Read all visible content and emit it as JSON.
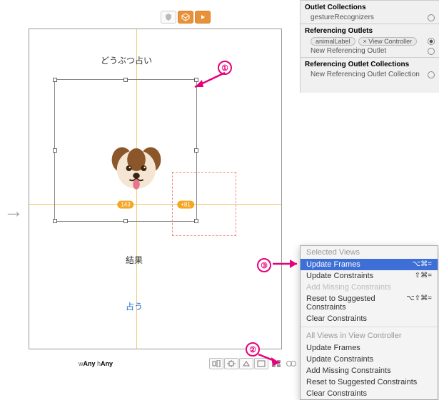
{
  "inspector": {
    "outlet_collections": "Outlet Collections",
    "gesture": "gestureRecognizers",
    "ref_outlets": "Referencing Outlets",
    "animal_label": "animalLabel",
    "view_controller": "× View Controller",
    "new_ref_outlet": "New Referencing Outlet",
    "ref_outlet_collections": "Referencing Outlet Collections",
    "new_ref_outlet_collection": "New Referencing Outlet Collection"
  },
  "canvas": {
    "title_label": "どうぶつ占い",
    "result_label": "結果",
    "action_label": "占う",
    "badge1": "143",
    "badge2": "+81"
  },
  "sizeclass": {
    "w": "w",
    "any1": "Any",
    "h": " h",
    "any2": "Any"
  },
  "menu": {
    "header1": "Selected Views",
    "update_frames": "Update Frames",
    "update_frames_sc": "⌥⌘=",
    "update_constraints": "Update Constraints",
    "update_constraints_sc": "⇧⌘=",
    "add_missing": "Add Missing Constraints",
    "reset": "Reset to Suggested Constraints",
    "reset_sc": "⌥⇧⌘=",
    "clear": "Clear Constraints",
    "header2": "All Views in View Controller"
  },
  "annot": {
    "n1": "①",
    "n2": "②",
    "n3": "③"
  }
}
